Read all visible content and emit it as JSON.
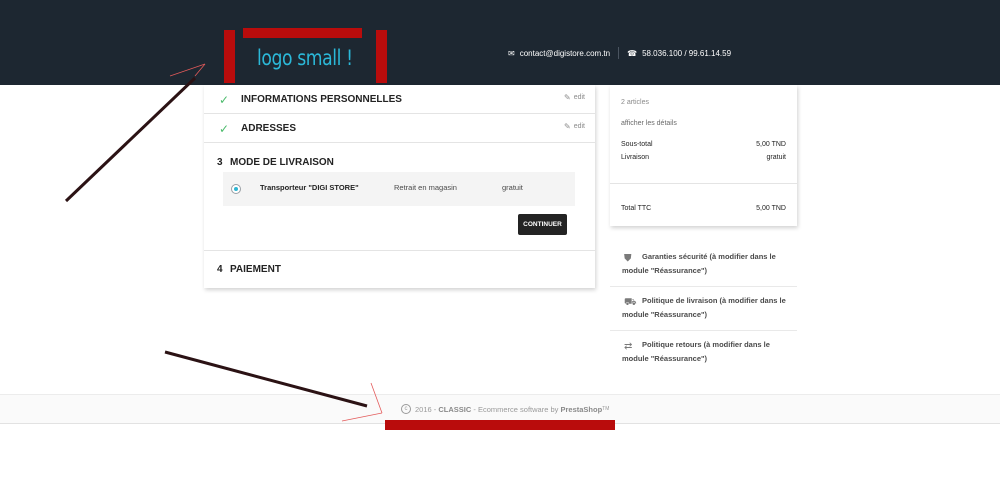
{
  "header": {
    "logo_text": "logo small !",
    "email": "contact@digistore.com.tn",
    "phone": "58.036.100 / 99.61.14.59",
    "email_icon": "envelope-icon",
    "phone_icon": "phone-icon"
  },
  "steps": {
    "personal": {
      "title": "INFORMATIONS PERSONNELLES",
      "edit": "edit"
    },
    "addresses": {
      "title": "ADRESSES",
      "edit": "edit"
    },
    "delivery": {
      "number": "3",
      "title": "MODE DE LIVRAISON",
      "carrier_name": "Transporteur \"DIGI STORE\"",
      "carrier_delay": "Retrait en magasin",
      "carrier_price": "gratuit",
      "continue": "CONTINUER"
    },
    "payment": {
      "number": "4",
      "title": "PAIEMENT"
    }
  },
  "summary": {
    "count": "2 articles",
    "details_link": "afficher les détails",
    "subtotal_label": "Sous-total",
    "subtotal_value": "5,00 TND",
    "shipping_label": "Livraison",
    "shipping_value": "gratuit",
    "total_label": "Total TTC",
    "total_value": "5,00 TND"
  },
  "reassurance": [
    {
      "icon": "shield-icon",
      "text": "Garanties sécurité (à modifier dans le module \"Réassurance\")"
    },
    {
      "icon": "truck-icon",
      "text": "Politique de livraison (à modifier dans le module \"Réassurance\")"
    },
    {
      "icon": "exchange-arrows-icon",
      "text": "Politique retours (à modifier dans le module \"Réassurance\")"
    }
  ],
  "footer": {
    "year": "2016",
    "dash1": " - ",
    "brand": "CLASSIC",
    "middle": " - Ecommerce software by ",
    "vendor": "PrestaShop",
    "tm": "TM"
  },
  "colors": {
    "header_bg": "#1d2731",
    "logo_red": "#b90c0c",
    "logo_text": "#2bb8d8",
    "check_green": "#4cbb6c",
    "radio_blue": "#2fb5d2",
    "button_dark": "#232323"
  }
}
